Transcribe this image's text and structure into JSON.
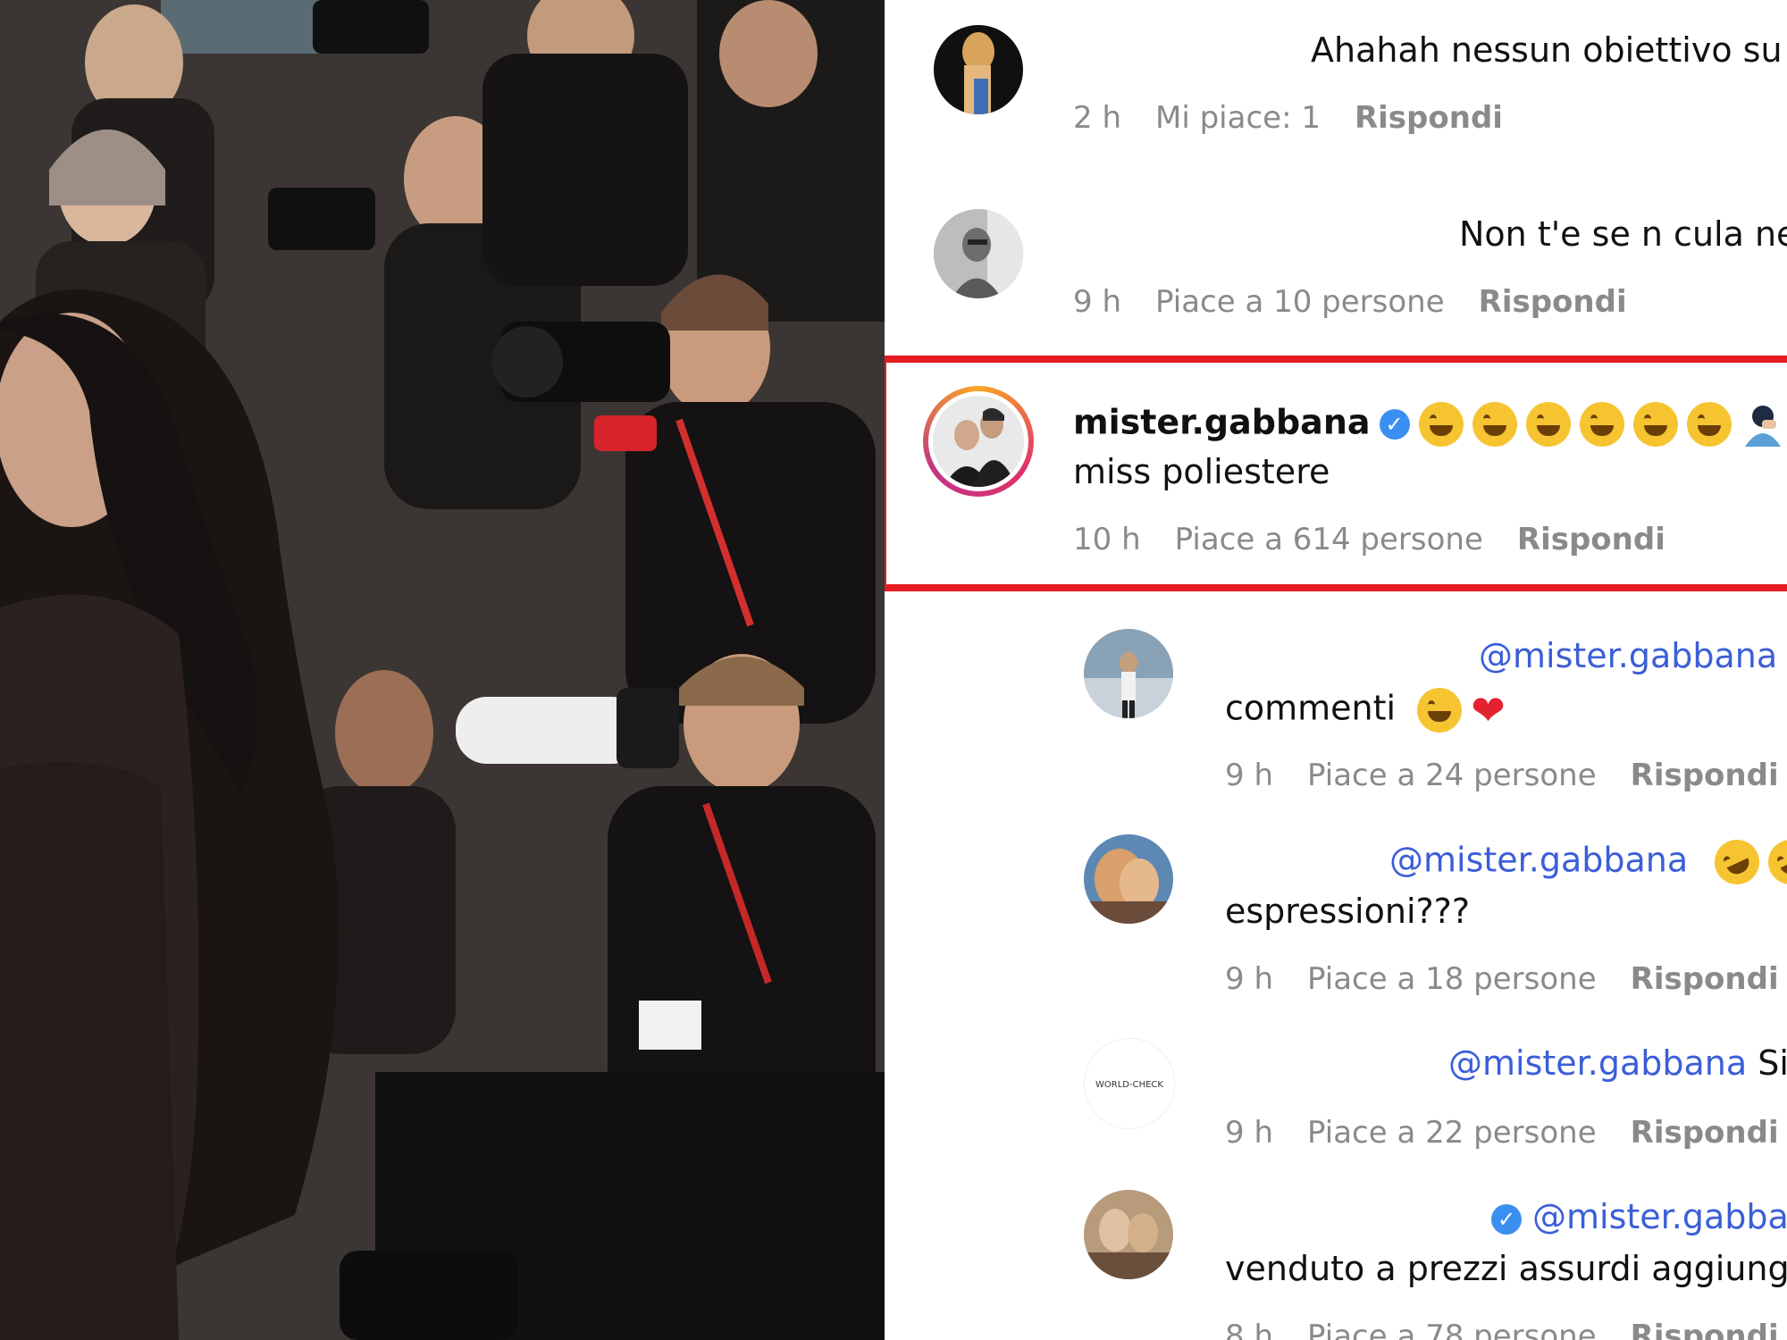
{
  "comments": [
    {
      "text": "Ahahah nessun obiettivo su",
      "time": "2 h",
      "likes": "Mi piace: 1",
      "reply": "Rispondi"
    },
    {
      "text": "Non t'e se n cula ne",
      "time": "9 h",
      "likes": "Piace a 10 persone",
      "reply": "Rispondi"
    },
    {
      "username": "mister.gabbana",
      "text": "miss poliestere",
      "time": "10 h",
      "likes": "Piace a 614 persone",
      "reply": "Rispondi"
    }
  ],
  "replies": [
    {
      "mention": "@mister.gabbana",
      "text": "commenti",
      "time": "9 h",
      "likes": "Piace a 24 persone",
      "reply": "Rispondi"
    },
    {
      "mention": "@mister.gabbana",
      "text": "espressioni???",
      "time": "9 h",
      "likes": "Piace a 18 persone",
      "reply": "Rispondi"
    },
    {
      "mention": "@mister.gabbana",
      "trailing": "Si",
      "time": "9 h",
      "likes": "Piace a 22 persone",
      "reply": "Rispondi"
    },
    {
      "mention": "@mister.gabba",
      "text": "venduto a prezzi assurdi aggiung",
      "time": "8 h",
      "likes": "Piace a 78 persone",
      "reply": "Rispondi"
    }
  ],
  "avatar_logo_text": "WORLD-CHECK",
  "colors": {
    "highlight_border": "#e51c23",
    "mention": "#3b5ed8",
    "verified": "#3b8ff0",
    "meta_text": "#8a8a8a"
  }
}
